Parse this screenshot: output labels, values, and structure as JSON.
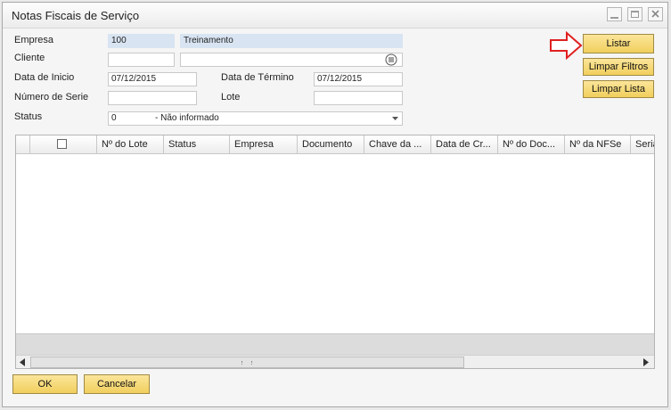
{
  "window": {
    "title": "Notas Fiscais de Serviço"
  },
  "form": {
    "empresa_label": "Empresa",
    "empresa_code": "100",
    "empresa_name": "Treinamento",
    "cliente_label": "Cliente",
    "cliente_code": "",
    "cliente_name": "",
    "data_inicio_label": "Data de Inicio",
    "data_inicio_value": "07/12/2015",
    "data_termino_label": "Data de Término",
    "data_termino_value": "07/12/2015",
    "numero_serie_label": "Número de Serie",
    "numero_serie_value": "",
    "lote_label": "Lote",
    "lote_value": "",
    "status_label": "Status",
    "status_code": "0",
    "status_text": "- Não informado"
  },
  "buttons": {
    "listar": "Listar",
    "limpar_filtros": "Limpar Filtros",
    "limpar_lista": "Limpar Lista",
    "ok": "OK",
    "cancelar": "Cancelar"
  },
  "grid": {
    "columns": [
      "Nº do Lote",
      "Status",
      "Empresa",
      "Documento",
      "Chave da ...",
      "Data de Cr...",
      "Nº do Doc...",
      "Nº da NFSe",
      "Seria"
    ],
    "rows": []
  },
  "colors": {
    "accent_button": "#f1cf5d",
    "readonly_field": "#d8e4f2",
    "arrow_red": "#e02020"
  },
  "icons": {
    "cliente_choose": "list-choose-icon",
    "status_dropdown": "chevron-down-icon",
    "annotation": "red-arrow-icon"
  }
}
